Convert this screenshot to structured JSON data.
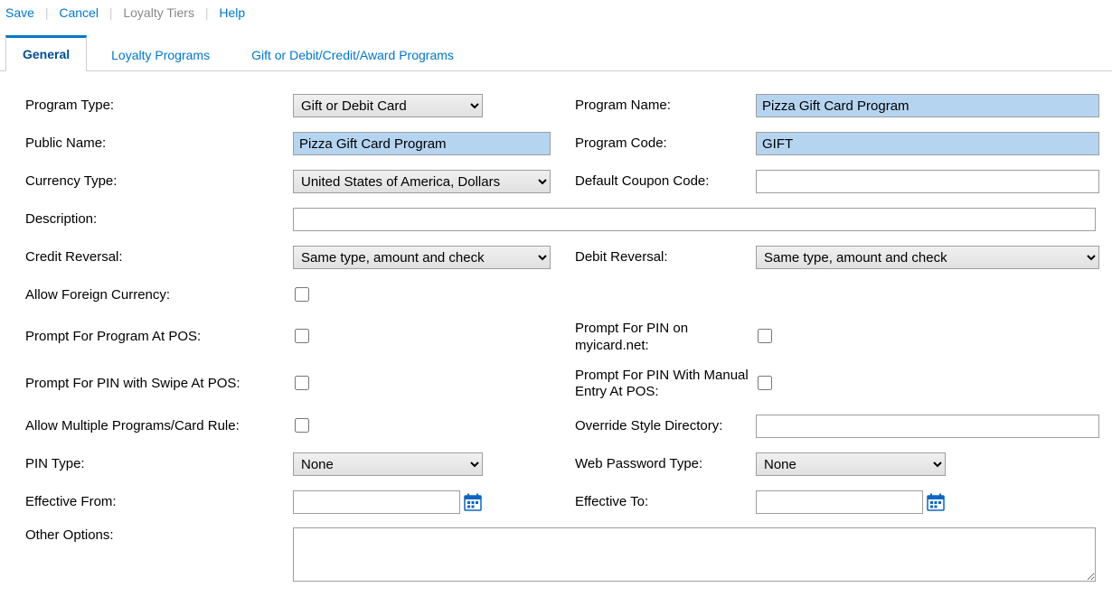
{
  "toolbar": {
    "save": "Save",
    "cancel": "Cancel",
    "loyalty_tiers": "Loyalty Tiers",
    "help": "Help"
  },
  "tabs": {
    "general": "General",
    "loyalty_programs": "Loyalty Programs",
    "gift_programs": "Gift or Debit/Credit/Award Programs"
  },
  "labels": {
    "program_type": "Program Type:",
    "program_name": "Program Name:",
    "public_name": "Public Name:",
    "program_code": "Program Code:",
    "currency_type": "Currency Type:",
    "default_coupon_code": "Default Coupon Code:",
    "description": "Description:",
    "credit_reversal": "Credit Reversal:",
    "debit_reversal": "Debit Reversal:",
    "allow_foreign_currency": "Allow Foreign Currency:",
    "prompt_program_pos": "Prompt For Program At POS:",
    "prompt_pin_myicard": "Prompt For PIN on myicard.net:",
    "prompt_pin_swipe": "Prompt For PIN with Swipe At POS:",
    "prompt_pin_manual": "Prompt For PIN With Manual Entry At POS:",
    "allow_multiple_programs": "Allow Multiple Programs/Card Rule:",
    "override_style_dir": "Override Style Directory:",
    "pin_type": "PIN Type:",
    "web_password_type": "Web Password Type:",
    "effective_from": "Effective From:",
    "effective_to": "Effective To:",
    "other_options": "Other Options:"
  },
  "values": {
    "program_type": "Gift or Debit Card",
    "program_name": "Pizza Gift Card Program",
    "public_name": "Pizza Gift Card Program",
    "program_code": "GIFT",
    "currency_type": "United States of America, Dollars",
    "default_coupon_code": "",
    "description": "",
    "credit_reversal": "Same type, amount and check",
    "debit_reversal": "Same type, amount and check",
    "pin_type": "None",
    "web_password_type": "None",
    "effective_from": "",
    "effective_to": "",
    "override_style_dir": "",
    "other_options": ""
  }
}
